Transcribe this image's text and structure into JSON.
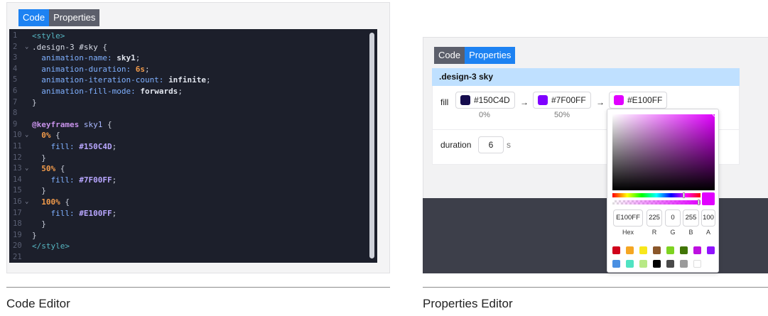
{
  "left": {
    "tabs": [
      {
        "label": "Code",
        "active": true
      },
      {
        "label": "Properties",
        "active": false
      }
    ],
    "code_lines": [
      {
        "n": "1",
        "fold": "",
        "tokens": [
          [
            "t-tag",
            "<style>"
          ]
        ]
      },
      {
        "n": "2",
        "fold": "⌄",
        "tokens": [
          [
            "t-sel",
            ".design-3 "
          ],
          [
            "t-id",
            "#sky"
          ],
          [
            "t-punc",
            " {"
          ]
        ]
      },
      {
        "n": "3",
        "fold": "",
        "tokens": [
          [
            "t-prop",
            "  animation-name: "
          ],
          [
            "t-val",
            "sky1"
          ],
          [
            "t-punc",
            ";"
          ]
        ]
      },
      {
        "n": "4",
        "fold": "",
        "tokens": [
          [
            "t-prop",
            "  animation-duration: "
          ],
          [
            "t-num",
            "6s"
          ],
          [
            "t-punc",
            ";"
          ]
        ]
      },
      {
        "n": "5",
        "fold": "",
        "tokens": [
          [
            "t-prop",
            "  animation-iteration-count: "
          ],
          [
            "t-val",
            "infinite"
          ],
          [
            "t-punc",
            ";"
          ]
        ]
      },
      {
        "n": "6",
        "fold": "",
        "tokens": [
          [
            "t-prop",
            "  animation-fill-mode: "
          ],
          [
            "t-val",
            "forwards"
          ],
          [
            "t-punc",
            ";"
          ]
        ]
      },
      {
        "n": "7",
        "fold": "",
        "tokens": [
          [
            "t-punc",
            "}"
          ]
        ]
      },
      {
        "n": "8",
        "fold": "",
        "tokens": []
      },
      {
        "n": "9",
        "fold": "",
        "tokens": [
          [
            "t-at",
            "@keyframes "
          ],
          [
            "t-kf",
            "sky1"
          ],
          [
            "t-punc",
            " {"
          ]
        ]
      },
      {
        "n": "10",
        "fold": "⌄",
        "tokens": [
          [
            "t-pct",
            "  0%"
          ],
          [
            "t-punc",
            " {"
          ]
        ]
      },
      {
        "n": "11",
        "fold": "",
        "tokens": [
          [
            "t-prop",
            "    fill: "
          ],
          [
            "t-hex",
            "#150C4D"
          ],
          [
            "t-punc",
            ";"
          ]
        ]
      },
      {
        "n": "12",
        "fold": "",
        "tokens": [
          [
            "t-punc",
            "  }"
          ]
        ]
      },
      {
        "n": "13",
        "fold": "⌄",
        "tokens": [
          [
            "t-pct",
            "  50%"
          ],
          [
            "t-punc",
            " {"
          ]
        ]
      },
      {
        "n": "14",
        "fold": "",
        "tokens": [
          [
            "t-prop",
            "    fill: "
          ],
          [
            "t-hex",
            "#7F00FF"
          ],
          [
            "t-punc",
            ";"
          ]
        ]
      },
      {
        "n": "15",
        "fold": "",
        "tokens": [
          [
            "t-punc",
            "  }"
          ]
        ]
      },
      {
        "n": "16",
        "fold": "⌄",
        "tokens": [
          [
            "t-pct",
            "  100%"
          ],
          [
            "t-punc",
            " {"
          ]
        ]
      },
      {
        "n": "17",
        "fold": "",
        "tokens": [
          [
            "t-prop",
            "    fill: "
          ],
          [
            "t-hex",
            "#E100FF"
          ],
          [
            "t-punc",
            ";"
          ]
        ]
      },
      {
        "n": "18",
        "fold": "",
        "tokens": [
          [
            "t-punc",
            "  }"
          ]
        ]
      },
      {
        "n": "19",
        "fold": "",
        "tokens": [
          [
            "t-punc",
            "}"
          ]
        ]
      },
      {
        "n": "20",
        "fold": "",
        "tokens": [
          [
            "t-tag",
            "</style>"
          ]
        ]
      },
      {
        "n": "21",
        "fold": "",
        "tokens": []
      }
    ],
    "caption": "Code Editor"
  },
  "right": {
    "tabs": [
      {
        "label": "Code",
        "active": false
      },
      {
        "label": "Properties",
        "active": true
      }
    ],
    "selector": ".design-3 sky",
    "fill_label": "fill",
    "stops": [
      {
        "hex": "#150C4D",
        "color": "#150C4D",
        "label": "0%"
      },
      {
        "hex": "#7F00FF",
        "color": "#7F00FF",
        "label": "50%"
      },
      {
        "hex": "#E100FF",
        "color": "#E100FF",
        "label": ""
      }
    ],
    "arrow": "→",
    "duration_label": "duration",
    "duration_value": "6",
    "duration_unit": "s",
    "caption": "Properties Editor",
    "picker": {
      "current_color": "#E100FF",
      "fields": [
        {
          "value": "E100FF",
          "label": "Hex"
        },
        {
          "value": "225",
          "label": "R"
        },
        {
          "value": "0",
          "label": "G"
        },
        {
          "value": "255",
          "label": "B"
        },
        {
          "value": "100",
          "label": "A"
        }
      ],
      "presets": [
        "#D0021B",
        "#F5A623",
        "#F8E71C",
        "#8B572A",
        "#7ED321",
        "#417505",
        "#BD10E0",
        "#9013FE",
        "#4A90E2",
        "#50E3C2",
        "#B8E986",
        "#000000",
        "#4A4A4A",
        "#9B9B9B",
        "#FFFFFF"
      ]
    }
  }
}
